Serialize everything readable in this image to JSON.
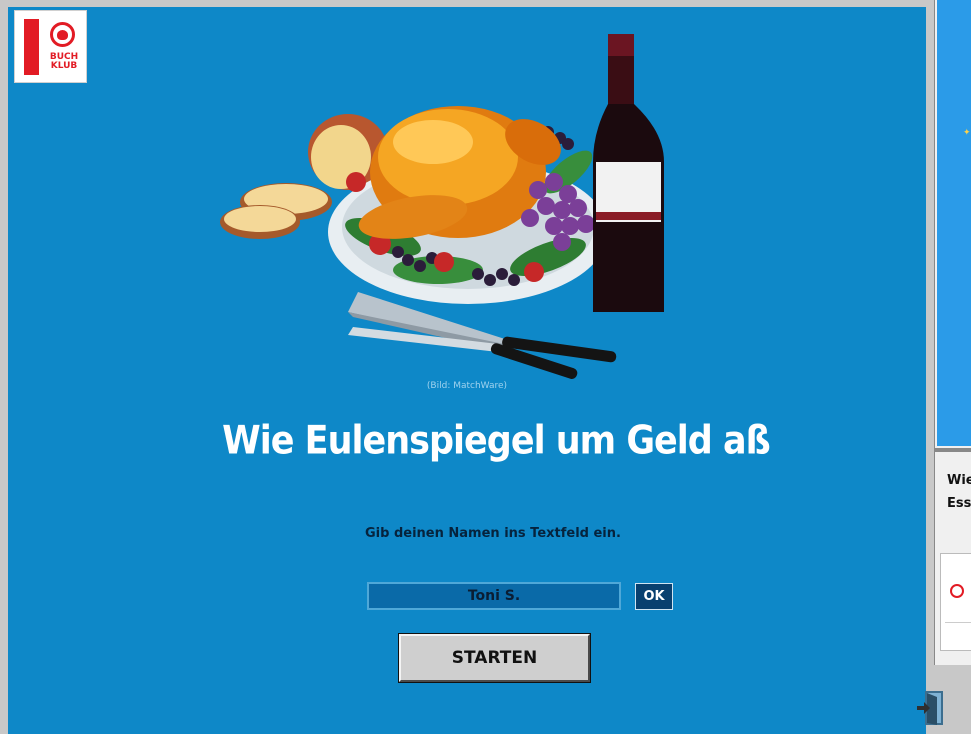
{
  "app": {
    "logo": {
      "line1": "BUCH",
      "line2": "KLUB"
    },
    "image_credit": "(Bild: MatchWare)",
    "title": "Wie Eulenspiegel um Geld aß",
    "instruction": "Gib deinen Namen ins Textfeld ein.",
    "name_field": {
      "value": "Toni S."
    },
    "ok_label": "OK",
    "start_label": "STARTEN"
  },
  "side_window": {
    "text_line1": "Wie",
    "text_line2": "Ess"
  },
  "icons": {
    "exit": "exit-door-icon",
    "illustration": "roast-chicken-wine-illustration"
  },
  "colors": {
    "stage_background": "#0e88c8",
    "title_text": "#ffffff",
    "logo_red": "#e21b24",
    "ok_button": "#08406f",
    "start_button": "#cfcfcf"
  }
}
